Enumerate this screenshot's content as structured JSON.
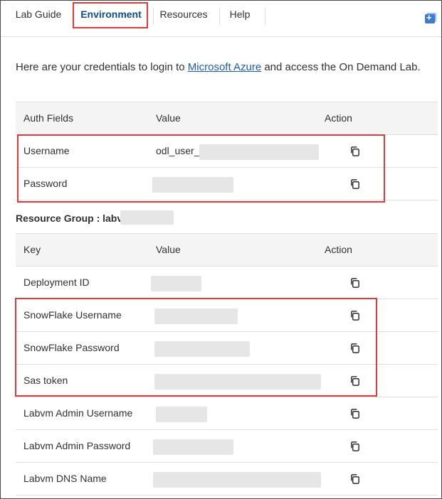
{
  "tabs": [
    {
      "label": "Lab Guide"
    },
    {
      "label": "Environment"
    },
    {
      "label": "Resources"
    },
    {
      "label": "Help"
    }
  ],
  "intro": {
    "before": "Here are your credentials to login to ",
    "link": "Microsoft Azure",
    "after": " and access the On Demand Lab."
  },
  "auth_table": {
    "headers": {
      "field": "Auth Fields",
      "value": "Value",
      "action": "Action"
    },
    "rows": [
      {
        "field": "Username",
        "value": "odl_user_"
      },
      {
        "field": "Password",
        "value": ""
      }
    ]
  },
  "resource_group": {
    "label": "Resource Group : labvm-"
  },
  "resource_table": {
    "headers": {
      "field": "Key",
      "value": "Value",
      "action": "Action"
    },
    "rows": [
      {
        "field": "Deployment ID",
        "value": ""
      },
      {
        "field": "SnowFlake Username",
        "value": ""
      },
      {
        "field": "SnowFlake Password",
        "value": ""
      },
      {
        "field": "Sas token",
        "value": ""
      },
      {
        "field": "Labvm Admin Username",
        "value": ""
      },
      {
        "field": "Labvm Admin Password",
        "value": ""
      },
      {
        "field": "Labvm DNS Name",
        "value": ""
      }
    ]
  },
  "colors": {
    "active_tab": "#0f4c8a",
    "highlight": "#e03a3a",
    "link": "#1a5fb4"
  },
  "icons": {
    "copy": "copy-icon",
    "corner": "new-window-icon"
  }
}
